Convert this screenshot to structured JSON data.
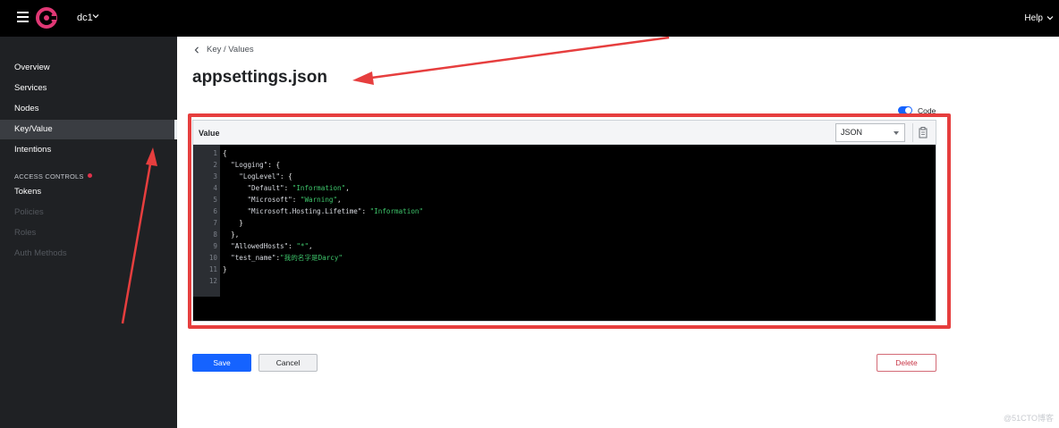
{
  "topbar": {
    "datacenter": "dc1",
    "help": "Help"
  },
  "sidebar": {
    "items": [
      {
        "label": "Overview"
      },
      {
        "label": "Services"
      },
      {
        "label": "Nodes"
      },
      {
        "label": "Key/Value"
      },
      {
        "label": "Intentions"
      }
    ],
    "section": "ACCESS CONTROLS",
    "acl_items": [
      {
        "label": "Tokens"
      },
      {
        "label": "Policies"
      },
      {
        "label": "Roles"
      },
      {
        "label": "Auth Methods"
      }
    ]
  },
  "breadcrumb": "Key / Values",
  "page_title": "appsettings.json",
  "toggle": {
    "label": "Code",
    "on": true
  },
  "editor": {
    "label": "Value",
    "language": "JSON",
    "lines": [
      "1",
      "2",
      "3",
      "4",
      "5",
      "6",
      "7",
      "8",
      "9",
      "10",
      "11",
      "12"
    ]
  },
  "buttons": {
    "save": "Save",
    "cancel": "Cancel",
    "delete": "Delete"
  },
  "watermark": "@51CTO博客",
  "colors": {
    "accent": "#1563ff",
    "annotation": "#e63e3e",
    "sidebar": "#1f2124"
  }
}
